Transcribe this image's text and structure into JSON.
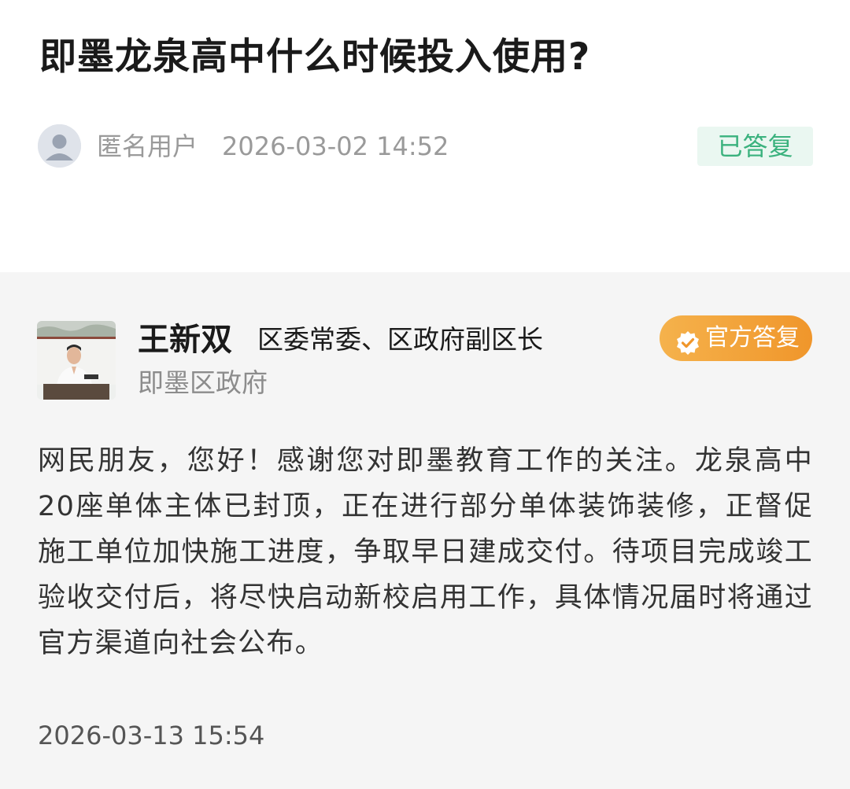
{
  "question": {
    "title": "即墨龙泉高中什么时候投入使用?",
    "asker": {
      "name": "匿名用户",
      "avatar_icon": "user-silhouette-icon",
      "time": "2026-03-02 14:52"
    },
    "status": "已答复",
    "status_color": "#3bb27e"
  },
  "answer": {
    "official": {
      "name": "王新双",
      "position": "区委常委、区政府副区长",
      "organization": "即墨区政府",
      "photo": "official-portrait"
    },
    "badge": {
      "label": "官方答复",
      "icon": "verified-check-icon",
      "color": "#f0962b"
    },
    "body": "网民朋友，您好！感谢您对即墨教育工作的关注。龙泉高中20座单体主体已封顶，正在进行部分单体装饰装修，正督促施工单位加快施工进度，争取早日建成交付。待项目完成竣工验收交付后，将尽快启动新校启用工作，具体情况届时将通过官方渠道向社会公布。",
    "time": "2026-03-13 15:54"
  }
}
